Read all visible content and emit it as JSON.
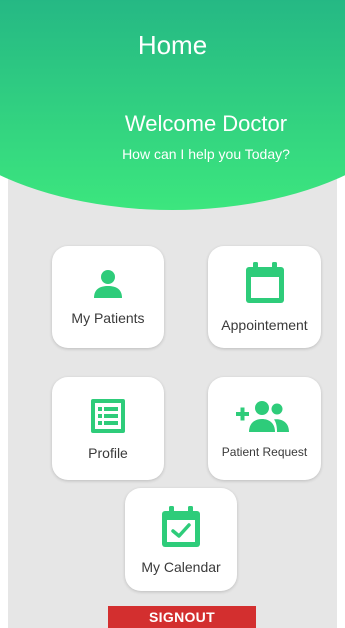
{
  "header": {
    "title": "Home",
    "welcome": "Welcome Doctor",
    "subtitle": "How can I help you Today?"
  },
  "cards": {
    "my_patients": {
      "label": "My Patients",
      "icon": "person-icon"
    },
    "appointment": {
      "label": "Appointement",
      "icon": "calendar-icon"
    },
    "profile": {
      "label": "Profile",
      "icon": "list-document-icon"
    },
    "patient_request": {
      "label": "Patient Request",
      "icon": "add-group-icon"
    },
    "my_calendar": {
      "label": "My Calendar",
      "icon": "calendar-check-icon"
    }
  },
  "signout": {
    "label": "SIGNOUT"
  },
  "colors": {
    "accent_green": "#2ecc7a",
    "header_top": "#1f9b87",
    "header_bottom": "#3ce67e",
    "signout_red": "#d32f2f",
    "background": "#e6e6e6"
  }
}
